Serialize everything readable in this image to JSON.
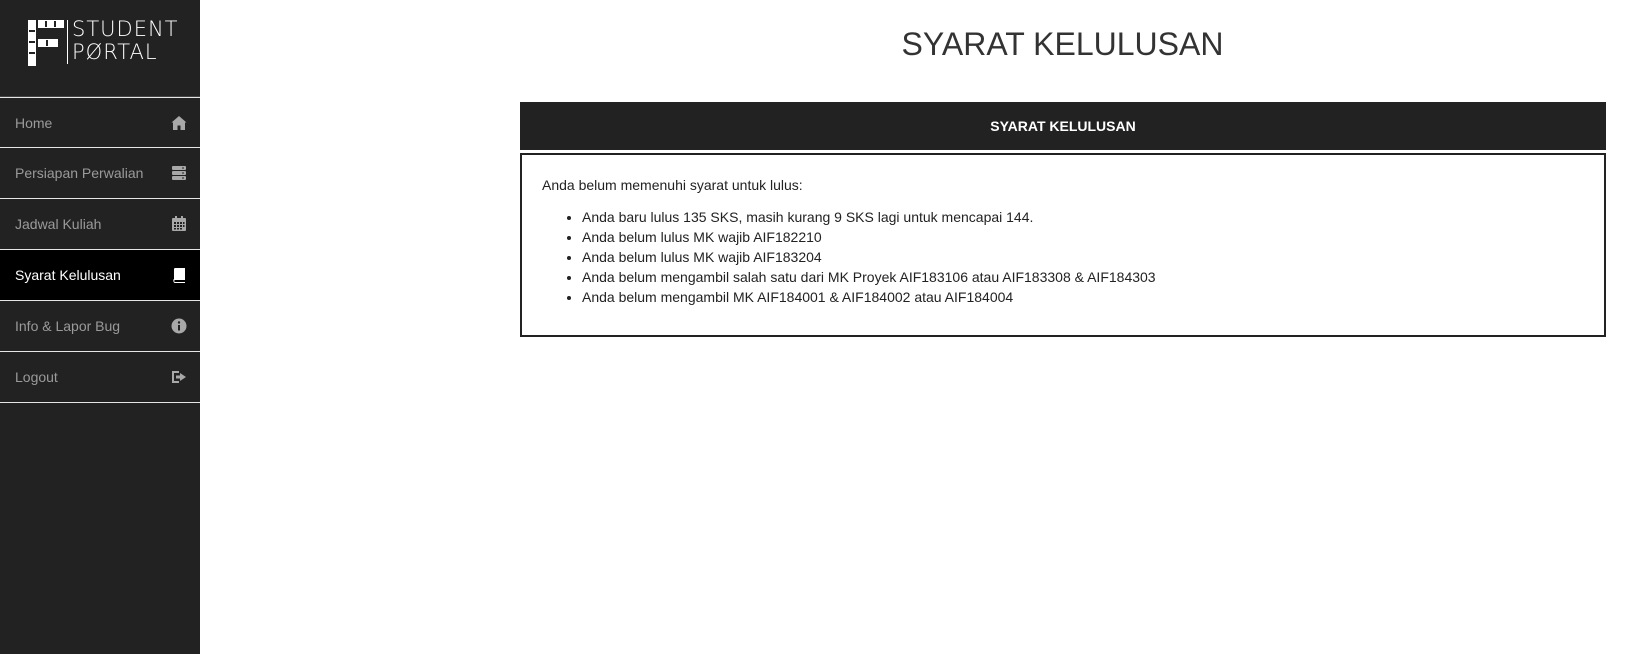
{
  "logo": {
    "line1": "STUDENT",
    "line2": "PØRTAL"
  },
  "nav": [
    {
      "label": "Home",
      "icon": "home-icon"
    },
    {
      "label": "Persiapan Perwalian",
      "icon": "server-icon"
    },
    {
      "label": "Jadwal Kuliah",
      "icon": "calendar-icon"
    },
    {
      "label": "Syarat Kelulusan",
      "icon": "book-icon",
      "active": true
    },
    {
      "label": "Info & Lapor Bug",
      "icon": "info-icon"
    },
    {
      "label": "Logout",
      "icon": "logout-icon"
    }
  ],
  "page": {
    "title": "SYARAT KELULUSAN"
  },
  "panel": {
    "header": "SYARAT KELULUSAN",
    "intro": "Anda belum memenuhi syarat untuk lulus:",
    "items": [
      "Anda baru lulus 135 SKS, masih kurang 9 SKS lagi untuk mencapai 144.",
      "Anda belum lulus MK wajib AIF182210",
      "Anda belum lulus MK wajib AIF183204",
      "Anda belum mengambil salah satu dari MK Proyek AIF183106 atau AIF183308 & AIF184303",
      "Anda belum mengambil MK AIF184001 & AIF184002 atau AIF184004"
    ]
  }
}
